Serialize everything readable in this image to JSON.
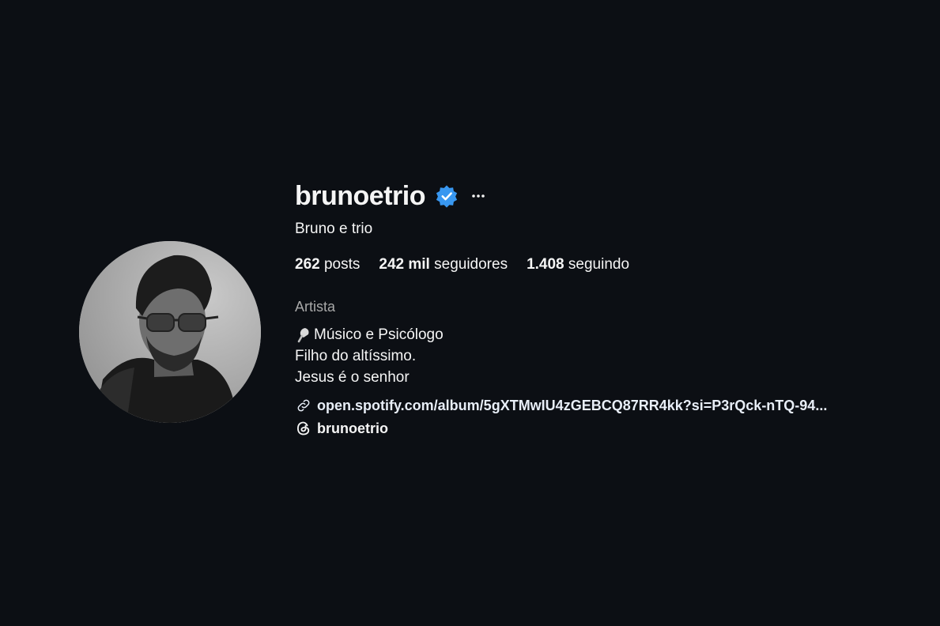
{
  "profile": {
    "username": "brunoetrio",
    "full_name": "Bruno e trio",
    "verified": true,
    "accent_color": "#3897f0",
    "stats": {
      "posts_count": "262",
      "posts_label": "posts",
      "followers_count": "242 mil",
      "followers_label": "seguidores",
      "following_count": "1.408",
      "following_label": "seguindo"
    },
    "category": "Artista",
    "bio": {
      "line1": "Músico e Psicólogo",
      "line1_icon": "microphone-icon",
      "line2": "Filho do altíssimo.",
      "line3": "Jesus é o senhor"
    },
    "link": {
      "icon": "link-icon",
      "text": "open.spotify.com/album/5gXTMwIU4zGEBCQ87RR4kk?si=P3rQck-nTQ-94..."
    },
    "threads": {
      "icon": "threads-icon",
      "text": "brunoetrio"
    }
  }
}
